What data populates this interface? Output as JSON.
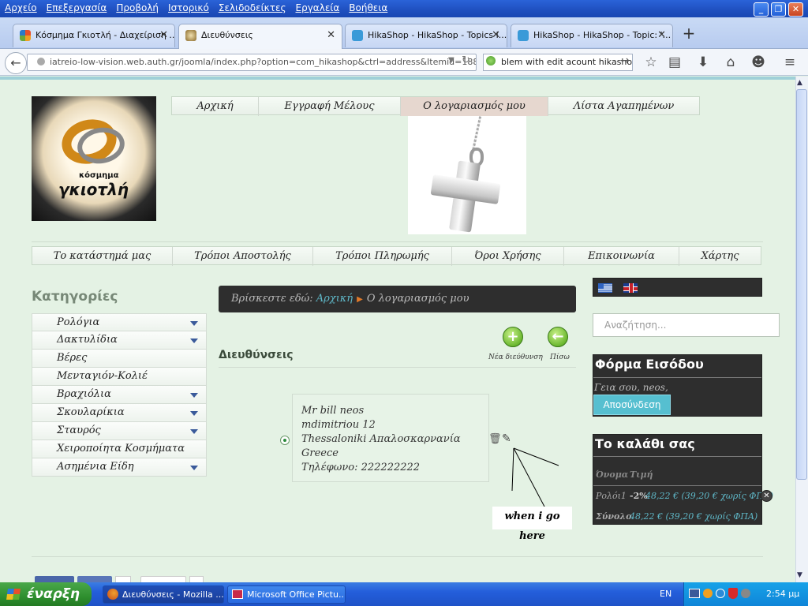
{
  "menubar": {
    "items": [
      "Αρχείο",
      "Επεξεργασία",
      "Προβολή",
      "Ιστορικό",
      "Σελιδοδείκτες",
      "Εργαλεία",
      "Βοήθεια"
    ]
  },
  "tabs": [
    {
      "title": "Κόσμημα Γκιοτλή - Διαχείριση ...",
      "icon": "joomla-icon"
    },
    {
      "title": "Διευθύνσεις",
      "icon": "site-favicon"
    },
    {
      "title": "HikaShop - HikaShop - Topics i...",
      "icon": "hikashop-icon"
    },
    {
      "title": "HikaShop - HikaShop - Topic: '...",
      "icon": "hikashop-icon"
    }
  ],
  "browser": {
    "url": "iatreio-low-vision.web.auth.gr/joomla/index.php?option=com_hikashop&ctrl=address&Itemid=188&lang=",
    "search": "blem with edit acount hikashop"
  },
  "topnav": [
    "Αρχική",
    "Εγγραφή Μέλους",
    "Ο λογαριασμός μου",
    "Λίστα Αγαπημένων"
  ],
  "logo": {
    "line1": "κόσμημα",
    "line2": "γκιοτλή"
  },
  "secnav": [
    "Το κατάστημά μας",
    "Τρόποι Αποστολής",
    "Τρόποι Πληρωμής",
    "Όροι Χρήσης",
    "Επικοινωνία",
    "Χάρτης"
  ],
  "categories": {
    "title": "Κατηγορίες",
    "items": [
      {
        "label": "Ρολόγια",
        "sub": true
      },
      {
        "label": "Δακτυλίδια",
        "sub": true
      },
      {
        "label": "Βέρες",
        "sub": false
      },
      {
        "label": "Μενταγιόν-Κολιέ",
        "sub": false
      },
      {
        "label": "Βραχιόλια",
        "sub": true
      },
      {
        "label": "Σκουλαρίκια",
        "sub": true
      },
      {
        "label": "Σταυρός",
        "sub": true
      },
      {
        "label": "Χειροποίητα Κοσμήματα",
        "sub": false
      },
      {
        "label": "Ασημένια Είδη",
        "sub": true
      }
    ]
  },
  "breadcrumb": {
    "prefix": "Βρίσκεστε εδώ:",
    "home": "Αρχική",
    "sep": "▶",
    "current": "Ο λογαριασμός μου"
  },
  "addresses": {
    "title": "Διευθύνσεις",
    "new_label": "Νέα διεύθυνση",
    "back_label": "Πίσω",
    "card": [
      "Mr bill neos",
      "mdimitriou 12",
      "Thessaloniki Απαλοσκαρνανία",
      "Greece",
      "Τηλέφωνο: 222222222"
    ]
  },
  "annotation": "when i go here",
  "search_placeholder": "Αναζήτηση...",
  "login": {
    "title": "Φόρμα Εισόδου",
    "greeting": "Γεια σου, neos,",
    "logout": "Αποσύνδεση"
  },
  "cart": {
    "title": "Το καλάθι σας",
    "col_name": "Όνομα",
    "col_price": "Τιμή",
    "item_name": "Ρολόι1",
    "item_discount": "-2%",
    "item_price": "48,22 € (39,20 € χωρίς ΦΠΑ)",
    "total_label": "Σύνολο",
    "total_price": "48,22 € (39,20 € χωρίς ΦΠΑ)"
  },
  "taskbar": {
    "start": "έναρξη",
    "items": [
      "Διευθύνσεις - Mozilla ...",
      "Microsoft Office Pictu..."
    ],
    "lang": "EN",
    "time": "2:54 μμ"
  },
  "colors": {
    "page_bg": "#e4f2e4",
    "dark_box": "#2e2e2e",
    "accent_blue": "#56bfd0",
    "link_blue": "#5fb8c8"
  }
}
